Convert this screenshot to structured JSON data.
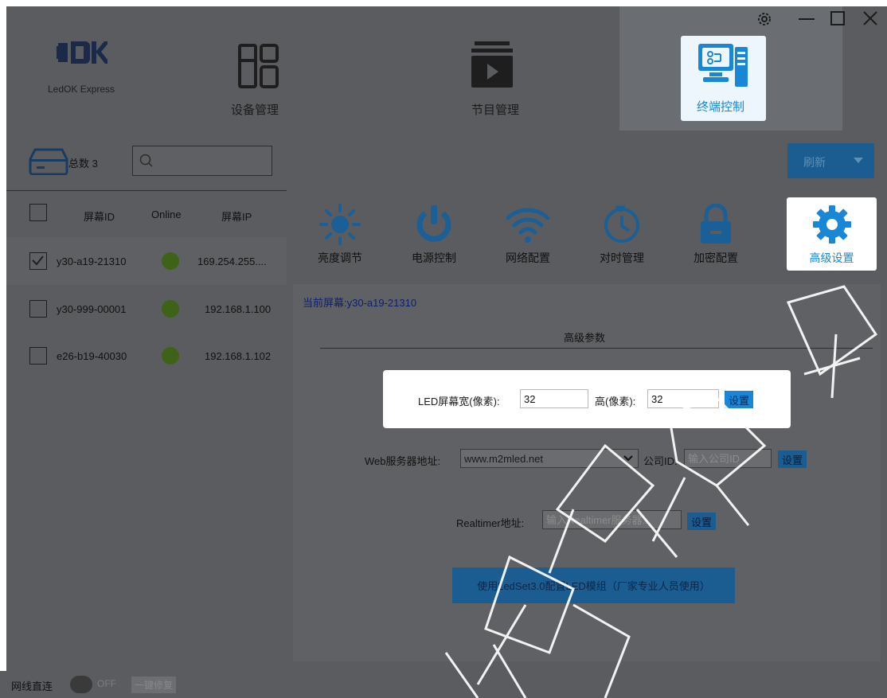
{
  "app": {
    "logo_text": "LedOK Express",
    "window_controls": [
      "settings-icon",
      "minimize-icon",
      "maximize-icon",
      "close-icon"
    ]
  },
  "nav": {
    "tabs": [
      {
        "label": "设备管理",
        "icon": "device-management-icon"
      },
      {
        "label": "节目管理",
        "icon": "program-management-icon"
      },
      {
        "label": "终端控制",
        "icon": "terminal-control-icon",
        "active": true
      }
    ]
  },
  "sidebar": {
    "total_label": "总数 3",
    "search_placeholder": "",
    "columns": [
      "屏幕ID",
      "Online",
      "屏幕IP"
    ],
    "rows": [
      {
        "id": "y30-a19-21310",
        "online": true,
        "ip": "169.254.255....",
        "checked": true
      },
      {
        "id": "y30-999-00001",
        "online": true,
        "ip": "192.168.1.100",
        "checked": false
      },
      {
        "id": "e26-b19-40030",
        "online": true,
        "ip": "192.168.1.102",
        "checked": false
      }
    ]
  },
  "status_bar": {
    "label": "网线直连",
    "toggle_text": "OFF",
    "repair_button": "一键修复"
  },
  "main": {
    "refresh_label": "刷新",
    "tools": [
      {
        "label": "亮度调节",
        "icon": "brightness-icon"
      },
      {
        "label": "电源控制",
        "icon": "power-icon"
      },
      {
        "label": "网络配置",
        "icon": "wifi-icon"
      },
      {
        "label": "对时管理",
        "icon": "clock-sync-icon"
      },
      {
        "label": "加密配置",
        "icon": "lock-icon"
      },
      {
        "label": "高级设置",
        "icon": "gear-icon",
        "active": true
      }
    ],
    "current_screen": "当前屏幕:y30-a19-21310",
    "section_title": "高级参数",
    "led_width_label": "LED屏幕宽(像素):",
    "led_width_value": "32",
    "led_height_label": "高(像素):",
    "led_height_value": "32",
    "set_label": "设置",
    "web_server_label": "Web服务器地址:",
    "web_server_value": "www.m2mled.net",
    "company_id_label": "公司ID:",
    "company_id_placeholder": "输入公司ID",
    "realtimer_label": "Realtimer地址:",
    "realtimer_placeholder": "输入Realtimer服务器...",
    "ledset_button": "使用LedSet3.0配置LED模组（厂家专业人员使用）"
  },
  "colors": {
    "accent": "#1a86d6",
    "dim_overlay": "#5b5c5f",
    "online_dot": "#3e6317"
  }
}
